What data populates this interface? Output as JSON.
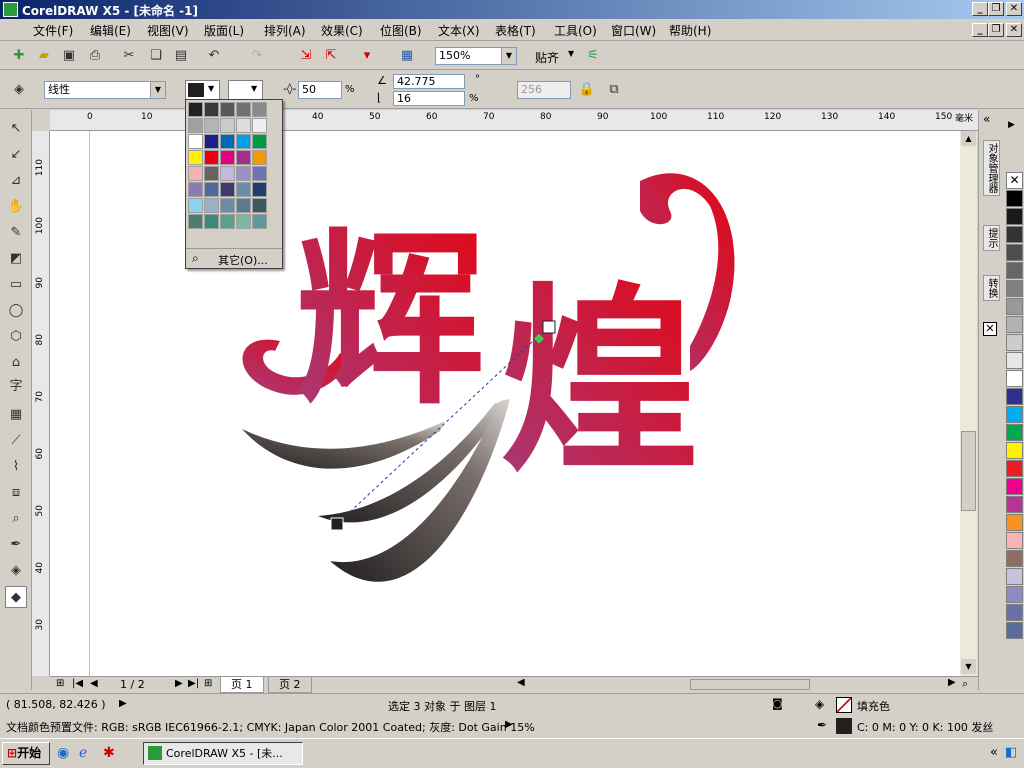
{
  "window": {
    "title": "CorelDRAW X5 - [未命名 -1]"
  },
  "menu": [
    "文件(F)",
    "编辑(E)",
    "视图(V)",
    "版面(L)",
    "排列(A)",
    "效果(C)",
    "位图(B)",
    "文本(X)",
    "表格(T)",
    "工具(O)",
    "窗口(W)",
    "帮助(H)"
  ],
  "stdbar": {
    "zoom": "150%",
    "snap": "贴齐"
  },
  "propbar": {
    "fill_type": "线性",
    "midpoint": "50",
    "angle": "42.775",
    "edge_pad": "16",
    "steps": "256",
    "pct1": "%",
    "pct2": "%",
    "deg": "°"
  },
  "colorpicker": {
    "other_label": "其它(O)..."
  },
  "ruler": {
    "unit": "毫米",
    "h_ticks": [
      "0",
      "10",
      "20",
      "30",
      "40",
      "50",
      "60",
      "70",
      "80",
      "90",
      "100",
      "110",
      "120",
      "130",
      "140",
      "150"
    ],
    "v_ticks": [
      "110",
      "100",
      "90",
      "80",
      "70",
      "60",
      "50",
      "40",
      "30"
    ]
  },
  "artwork": {
    "char1": "辉",
    "char2": "煌"
  },
  "pages": {
    "counter": "1 / 2",
    "tabs": [
      "页 1",
      "页 2"
    ]
  },
  "docker_tabs": [
    "对象管理器",
    "提示",
    "转换"
  ],
  "palette": [
    "#000000",
    "#1a1a1a",
    "#333333",
    "#4d4d4d",
    "#666666",
    "#808080",
    "#999999",
    "#b3b3b3",
    "#cccccc",
    "#e6e6e6",
    "#ffffff",
    "#2e3192",
    "#00aeef",
    "#00a651",
    "#fff200",
    "#ed1c24",
    "#ec008c",
    "#b83394",
    "#f7941d",
    "#f9b5b5",
    "#8c6e63",
    "#c8c2dd",
    "#8f8ac0",
    "#6b6fa8",
    "#5b6b9a"
  ],
  "status": {
    "coords": "( 81.508, 82.426 )",
    "selection": "选定 3 对象 于 图层 1",
    "fill_label": "填充色",
    "profile": "文档颜色预置文件: RGB: sRGB IEC61966-2.1; CMYK: Japan Color 2001 Coated; 灰度: Dot Gain 15%",
    "outline": "C: 0 M: 0 Y: 0 K: 100  发丝"
  },
  "taskbar": {
    "start": "开始",
    "task": "CorelDRAW X5 - [未..."
  },
  "colors": {
    "accent": "#0a246a",
    "fill_red": "#e30613",
    "fill_purple": "#a63a7a",
    "fill_dark": "#231f20"
  }
}
